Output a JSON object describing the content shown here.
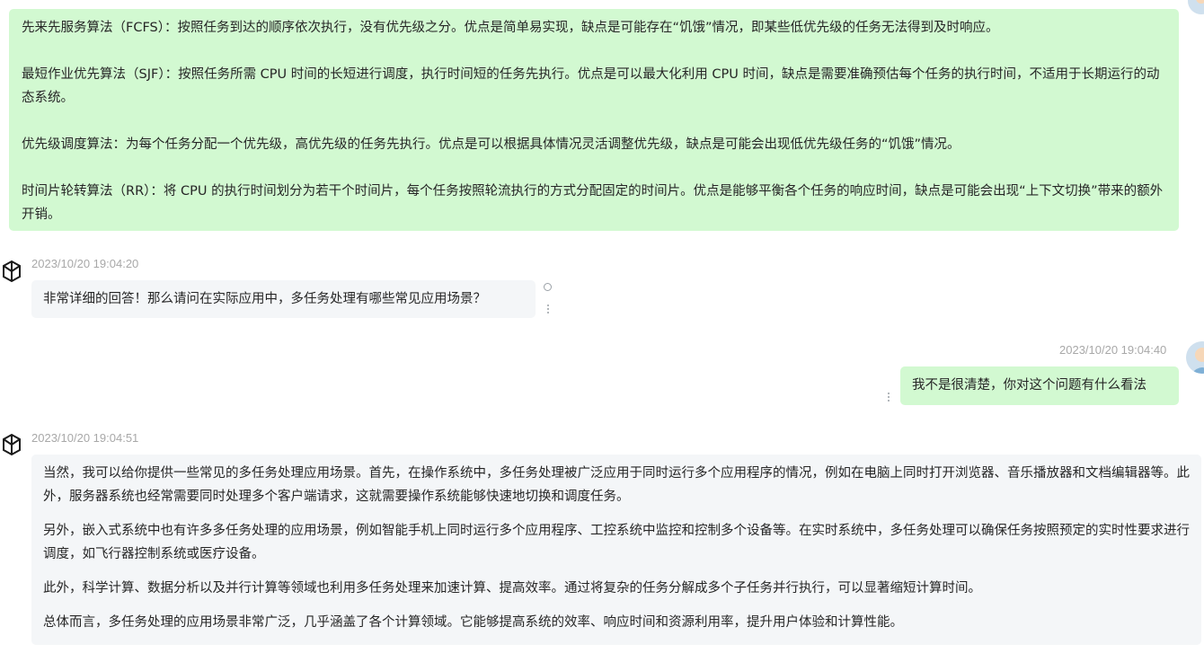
{
  "top_bubble": {
    "paragraphs": [
      "先来先服务算法（FCFS）：按照任务到达的顺序依次执行，没有优先级之分。优点是简单易实现，缺点是可能存在“饥饿”情况，即某些低优先级的任务无法得到及时响应。",
      "最短作业优先算法（SJF）：按照任务所需 CPU 时间的长短进行调度，执行时间短的任务先执行。优点是可以最大化利用 CPU 时间，缺点是需要准确预估每个任务的执行时间，不适用于长期运行的动态系统。",
      "优先级调度算法：为每个任务分配一个优先级，高优先级的任务先执行。优点是可以根据具体情况灵活调整优先级，缺点是可能会出现低优先级任务的“饥饿”情况。",
      "时间片轮转算法（RR）：将 CPU 的执行时间划分为若干个时间片，每个任务按照轮流执行的方式分配固定的时间片。优点是能够平衡各个任务的响应时间，缺点是可能会出现“上下文切换”带来的额外开销。"
    ]
  },
  "msg1": {
    "timestamp": "2023/10/20 19:04:20",
    "text": "非常详细的回答！那么请问在实际应用中，多任务处理有哪些常见应用场景？"
  },
  "msg2": {
    "timestamp": "2023/10/20 19:04:40",
    "text": "我不是很清楚，你对这个问题有什么看法"
  },
  "msg3": {
    "timestamp": "2023/10/20 19:04:51",
    "paragraphs": [
      "当然，我可以给你提供一些常见的多任务处理应用场景。首先，在操作系统中，多任务处理被广泛应用于同时运行多个应用程序的情况，例如在电脑上同时打开浏览器、音乐播放器和文档编辑器等。此外，服务器系统也经常需要同时处理多个客户端请求，这就需要操作系统能够快速地切换和调度任务。",
      "另外，嵌入式系统中也有许多多任务处理的应用场景，例如智能手机上同时运行多个应用程序、工控系统中监控和控制多个设备等。在实时系统中，多任务处理可以确保任务按照预定的实时性要求进行调度，如飞行器控制系统或医疗设备。",
      "此外，科学计算、数据分析以及并行计算等领域也利用多任务处理来加速计算、提高效率。通过将复杂的任务分解成多个子任务并行执行，可以显著缩短计算时间。",
      "总体而言，多任务处理的应用场景非常广泛，几乎涵盖了各个计算领域。它能够提高系统的效率、响应时间和资源利用率，提升用户体验和计算性能。"
    ]
  },
  "colors": {
    "user_bubble": "#d2f9d1",
    "bot_bubble": "#f4f6f8",
    "timestamp": "#a8a8a8"
  },
  "icons": [
    "openai-logo-icon",
    "user-avatar",
    "more-dots-icon",
    "circle-icon"
  ]
}
